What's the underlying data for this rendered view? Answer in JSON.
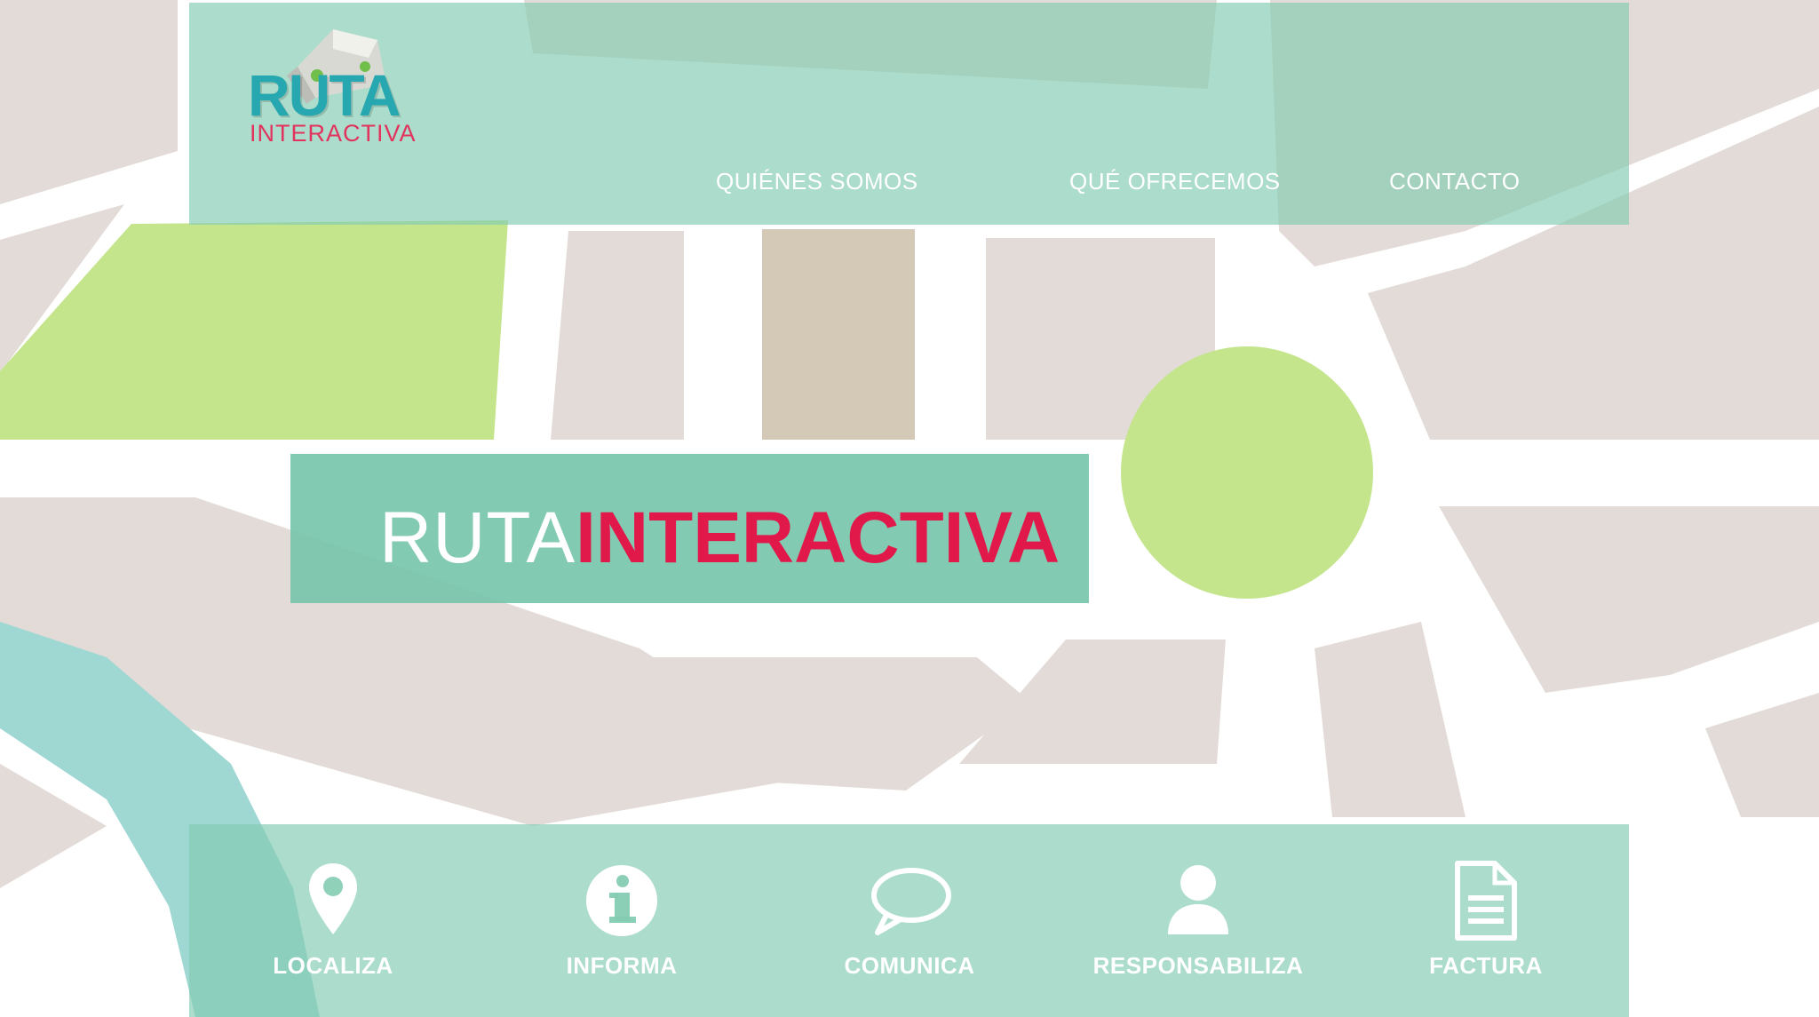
{
  "brand": {
    "logo_word": "RUTA",
    "logo_sub": "INTERACTIVA",
    "accent": "#e1194b",
    "logo_color": "#27a8b1",
    "panel_color": "#84ccb2"
  },
  "nav": {
    "items": [
      {
        "label": "QUIÉNES SOMOS"
      },
      {
        "label": "QUÉ OFRECEMOS"
      },
      {
        "label": "CONTACTO"
      }
    ]
  },
  "hero": {
    "light": "RUTA",
    "bold": "INTERACTIVA"
  },
  "features": [
    {
      "label": "LOCALIZA",
      "icon": "location-pin-icon"
    },
    {
      "label": "INFORMA",
      "icon": "info-icon"
    },
    {
      "label": "COMUNICA",
      "icon": "speech-bubble-icon"
    },
    {
      "label": "RESPONSABILIZA",
      "icon": "person-icon"
    },
    {
      "label": "FACTURA",
      "icon": "document-icon"
    }
  ],
  "map": {
    "park_color": "#c4e58c",
    "block_color": "#e3dbd7",
    "road_color": "#ffffff",
    "river_color": "#9fd7d3"
  }
}
